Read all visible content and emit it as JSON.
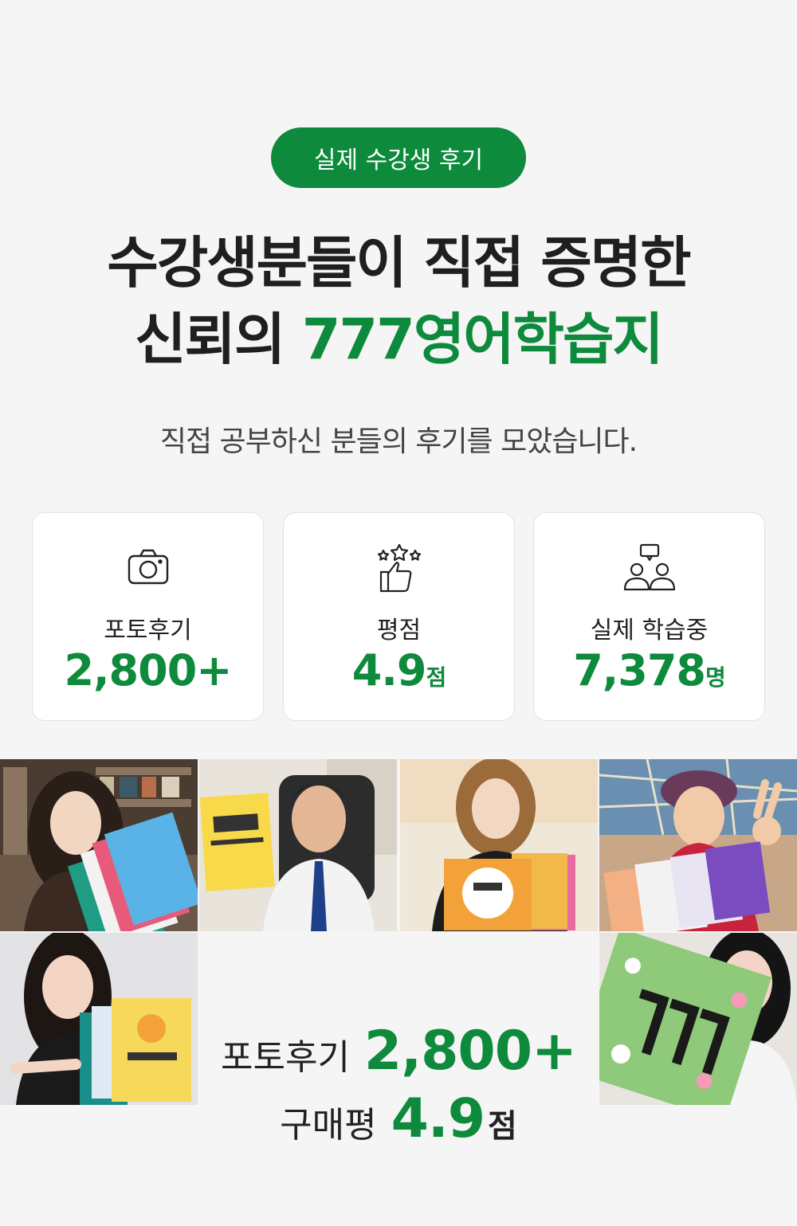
{
  "badge": "실제 수강생 후기",
  "headline": {
    "line1": "수강생분들이 직접 증명한",
    "line2_prefix": "신뢰의 ",
    "line2_accent": "777영어학습지"
  },
  "subtitle": "직접 공부하신 분들의 후기를 모았습니다.",
  "stats": [
    {
      "icon": "camera-icon",
      "label": "포토후기",
      "value": "2,800+",
      "unit": ""
    },
    {
      "icon": "thumbs-up-stars-icon",
      "label": "평점",
      "value": "4.9",
      "unit": "점"
    },
    {
      "icon": "people-chat-icon",
      "label": "실제 학습중",
      "value": "7,378",
      "unit": "명"
    }
  ],
  "photos": [
    {
      "name": "review-photo-woman-bookstore"
    },
    {
      "name": "review-photo-man-office"
    },
    {
      "name": "review-photo-woman-orange-book"
    },
    {
      "name": "review-photo-senior-woman-victory"
    },
    {
      "name": "review-photo-woman-pointing"
    },
    {
      "name": "review-photo-woman-gift-box"
    }
  ],
  "summary": {
    "photo_label": "포토후기",
    "photo_value": "2,800+",
    "rating_label": "구매평",
    "rating_value": "4.9",
    "rating_unit": "점"
  },
  "colors": {
    "accent": "#0e8a3c",
    "background": "#f5f5f5"
  }
}
